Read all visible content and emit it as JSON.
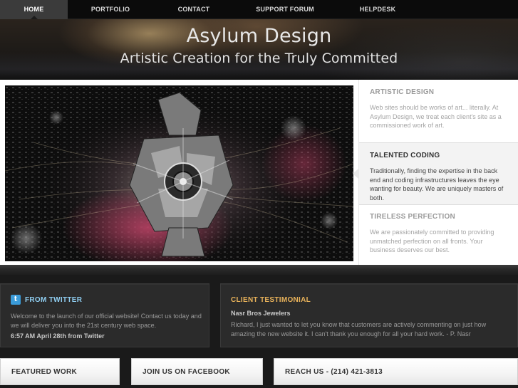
{
  "nav": {
    "items": [
      {
        "label": "HOME",
        "active": true
      },
      {
        "label": "PORTFOLIO",
        "active": false
      },
      {
        "label": "CONTACT",
        "active": false
      },
      {
        "label": "SUPPORT FORUM",
        "active": false
      },
      {
        "label": "HELPDESK",
        "active": false
      }
    ]
  },
  "header": {
    "title": "Asylum Design",
    "subtitle": "Artistic Creation for the Truly Committed"
  },
  "features": [
    {
      "title": "ARTISTIC DESIGN",
      "text": "Web sites should be works of art... literally. At Asylum Design, we treat each client's site as a commissioned work of art.",
      "active": false
    },
    {
      "title": "TALENTED CODING",
      "text": "Traditionally, finding the expertise in the back end and coding infrastructures leaves the eye wanting for beauty. We are uniquely masters of both.",
      "active": true
    },
    {
      "title": "TIRELESS PERFECTION",
      "text": "We are passionately committed to providing unmatched perfection on all fronts. Your business deserves our best.",
      "active": false
    }
  ],
  "twitter": {
    "icon": "twitter-icon",
    "title": "FROM TWITTER",
    "text": "Welcome to the launch of our official website! Contact us today and we will deliver you into the 21st century web space.",
    "meta": "6:57 AM April 28th from Twitter"
  },
  "testimonial": {
    "title": "CLIENT TESTIMONIAL",
    "name": "Nasr Bros Jewelers",
    "text": "Richard, I just wanted to let you know that customers are actively commenting on just how amazing the new website it. I can't thank you enough for all your hard work. - P. Nasr"
  },
  "buttons": {
    "featured": "FEATURED WORK",
    "facebook": "JOIN US ON FACEBOOK",
    "reach": "REACH US - (214) 421-3813"
  },
  "colors": {
    "twitter_accent": "#8fcdf0",
    "testimonial_accent": "#e8b25a",
    "twitter_icon_bg": "#3a9bd9"
  }
}
